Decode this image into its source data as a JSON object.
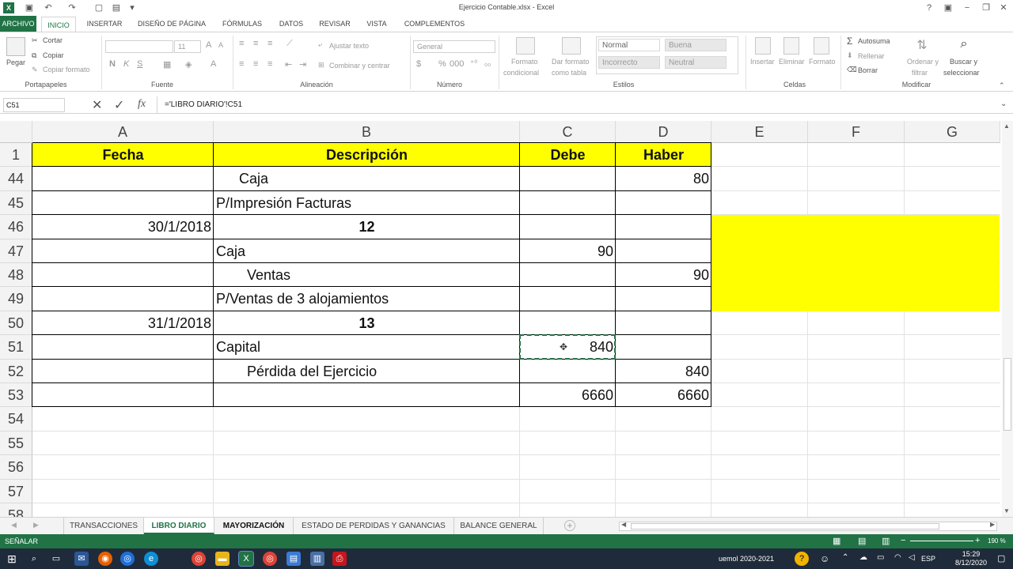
{
  "window": {
    "title": "Ejercicio Contable.xlsx - Excel"
  },
  "ribbon_tabs": [
    "ARCHIVO",
    "INICIO",
    "INSERTAR",
    "DISEÑO DE PÁGINA",
    "FÓRMULAS",
    "DATOS",
    "REVISAR",
    "VISTA",
    "COMPLEMENTOS"
  ],
  "ribbon": {
    "paste": "Pegar",
    "cut": "Cortar",
    "copy": "Copiar",
    "copy_format": "Copiar formato",
    "g_clipboard": "Portapapeles",
    "font_size": "11",
    "g_font": "Fuente",
    "wrap": "Ajustar texto",
    "merge": "Combinar y centrar",
    "g_align": "Alineación",
    "number_format": "General",
    "g_number": "Número",
    "cond_format_1": "Formato",
    "cond_format_2": "condicional",
    "table_1": "Dar formato",
    "table_2": "como tabla",
    "styles": {
      "normal": "Normal",
      "buena": "Buena",
      "incorrecto": "Incorrecto",
      "neutral": "Neutral"
    },
    "g_styles": "Estilos",
    "insert": "Insertar",
    "delete": "Eliminar",
    "format": "Formato",
    "g_cells": "Celdas",
    "autosum": "Autosuma",
    "fill": "Rellenar",
    "clear": "Borrar",
    "sort_1": "Ordenar y",
    "sort_2": "filtrar",
    "find_1": "Buscar y",
    "find_2": "seleccionar",
    "g_edit": "Modificar"
  },
  "formula_bar": {
    "name_box": "C51",
    "fx": "fx",
    "formula": "='LIBRO DIARIO'!C51"
  },
  "columns": [
    "A",
    "B",
    "C",
    "D",
    "E",
    "F",
    "G"
  ],
  "header_row": {
    "num": "1",
    "fecha": "Fecha",
    "descripcion": "Descripción",
    "debe": "Debe",
    "haber": "Haber"
  },
  "rows": [
    {
      "num": "44",
      "a": "",
      "b": "Caja",
      "b_indent": "mid",
      "b_bold": false,
      "c": "",
      "d": "80"
    },
    {
      "num": "45",
      "a": "",
      "b": "P/Impresión Facturas",
      "b_indent": "none",
      "b_bold": false,
      "c": "",
      "d": ""
    },
    {
      "num": "46",
      "a": "30/1/2018",
      "b": "12",
      "b_indent": "center",
      "b_bold": true,
      "c": "",
      "d": ""
    },
    {
      "num": "47",
      "a": "",
      "b": "Caja",
      "b_indent": "none",
      "b_bold": false,
      "c": "90",
      "d": ""
    },
    {
      "num": "48",
      "a": "",
      "b": "Ventas",
      "b_indent": "deep",
      "b_bold": false,
      "c": "",
      "d": "90"
    },
    {
      "num": "49",
      "a": "",
      "b": "P/Ventas de 3 alojamientos",
      "b_indent": "none",
      "b_bold": false,
      "c": "",
      "d": ""
    },
    {
      "num": "50",
      "a": "31/1/2018",
      "b": "13",
      "b_indent": "center",
      "b_bold": true,
      "c": "",
      "d": ""
    },
    {
      "num": "51",
      "a": "",
      "b": "Capital",
      "b_indent": "none",
      "b_bold": false,
      "c": "840",
      "d": ""
    },
    {
      "num": "52",
      "a": "",
      "b": "Pérdida del Ejercicio",
      "b_indent": "deep",
      "b_bold": false,
      "c": "",
      "d": "840"
    },
    {
      "num": "53",
      "a": "",
      "b": "",
      "b_indent": "none",
      "b_bold": false,
      "c": "6660",
      "d": "6660"
    }
  ],
  "empty_rows": [
    "54",
    "55",
    "56",
    "57",
    "58"
  ],
  "sheet_tabs": [
    "TRANSACCIONES",
    "LIBRO DIARIO",
    "MAYORIZACIÓN",
    "ESTADO DE PERDIDAS Y GANANCIAS",
    "BALANCE GENERAL"
  ],
  "active_sheet": "LIBRO DIARIO",
  "status": {
    "mode": "SEÑALAR",
    "zoom": "190 %"
  },
  "taskbar": {
    "tray_text": "uemol 2020-2021",
    "lang": "ESP",
    "time": "15:29",
    "date": "8/12/2020"
  },
  "colors": {
    "excel_green": "#217346",
    "highlight_yellow": "#ffff00"
  }
}
